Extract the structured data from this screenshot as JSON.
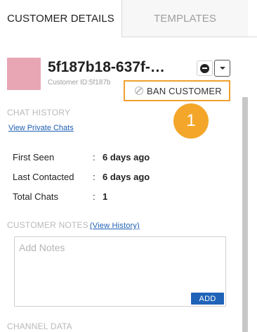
{
  "tabs": [
    {
      "label": "CUSTOMER DETAILS",
      "active": true
    },
    {
      "label": "TEMPLATES",
      "active": false
    }
  ],
  "customer": {
    "name": "5f187b18-637f-…",
    "id_label": "Customer ID:",
    "id_value": "5f187b",
    "avatar_color": "#e8a6b5"
  },
  "actions": {
    "ban_label": "BAN CUSTOMER",
    "block_icon": "minus-circle-icon",
    "dropdown_icon": "caret-down-icon"
  },
  "step_badge": "1",
  "chat_history": {
    "title": "CHAT HISTORY",
    "link": "View Private Chats",
    "rows": [
      {
        "label": "First Seen",
        "colon": ":",
        "value": "6 days ago"
      },
      {
        "label": "Last Contacted",
        "colon": ":",
        "value": "6 days ago"
      },
      {
        "label": "Total Chats",
        "colon": ":",
        "value": "1"
      }
    ]
  },
  "notes": {
    "title": "CUSTOMER NOTES",
    "history_link": "(View History)",
    "placeholder": "Add Notes",
    "add_label": "ADD"
  },
  "channel": {
    "title": "CHANNEL DATA"
  },
  "colors": {
    "accent": "#1e63b8",
    "highlight": "#f0a030",
    "badge": "#f4a62a"
  }
}
